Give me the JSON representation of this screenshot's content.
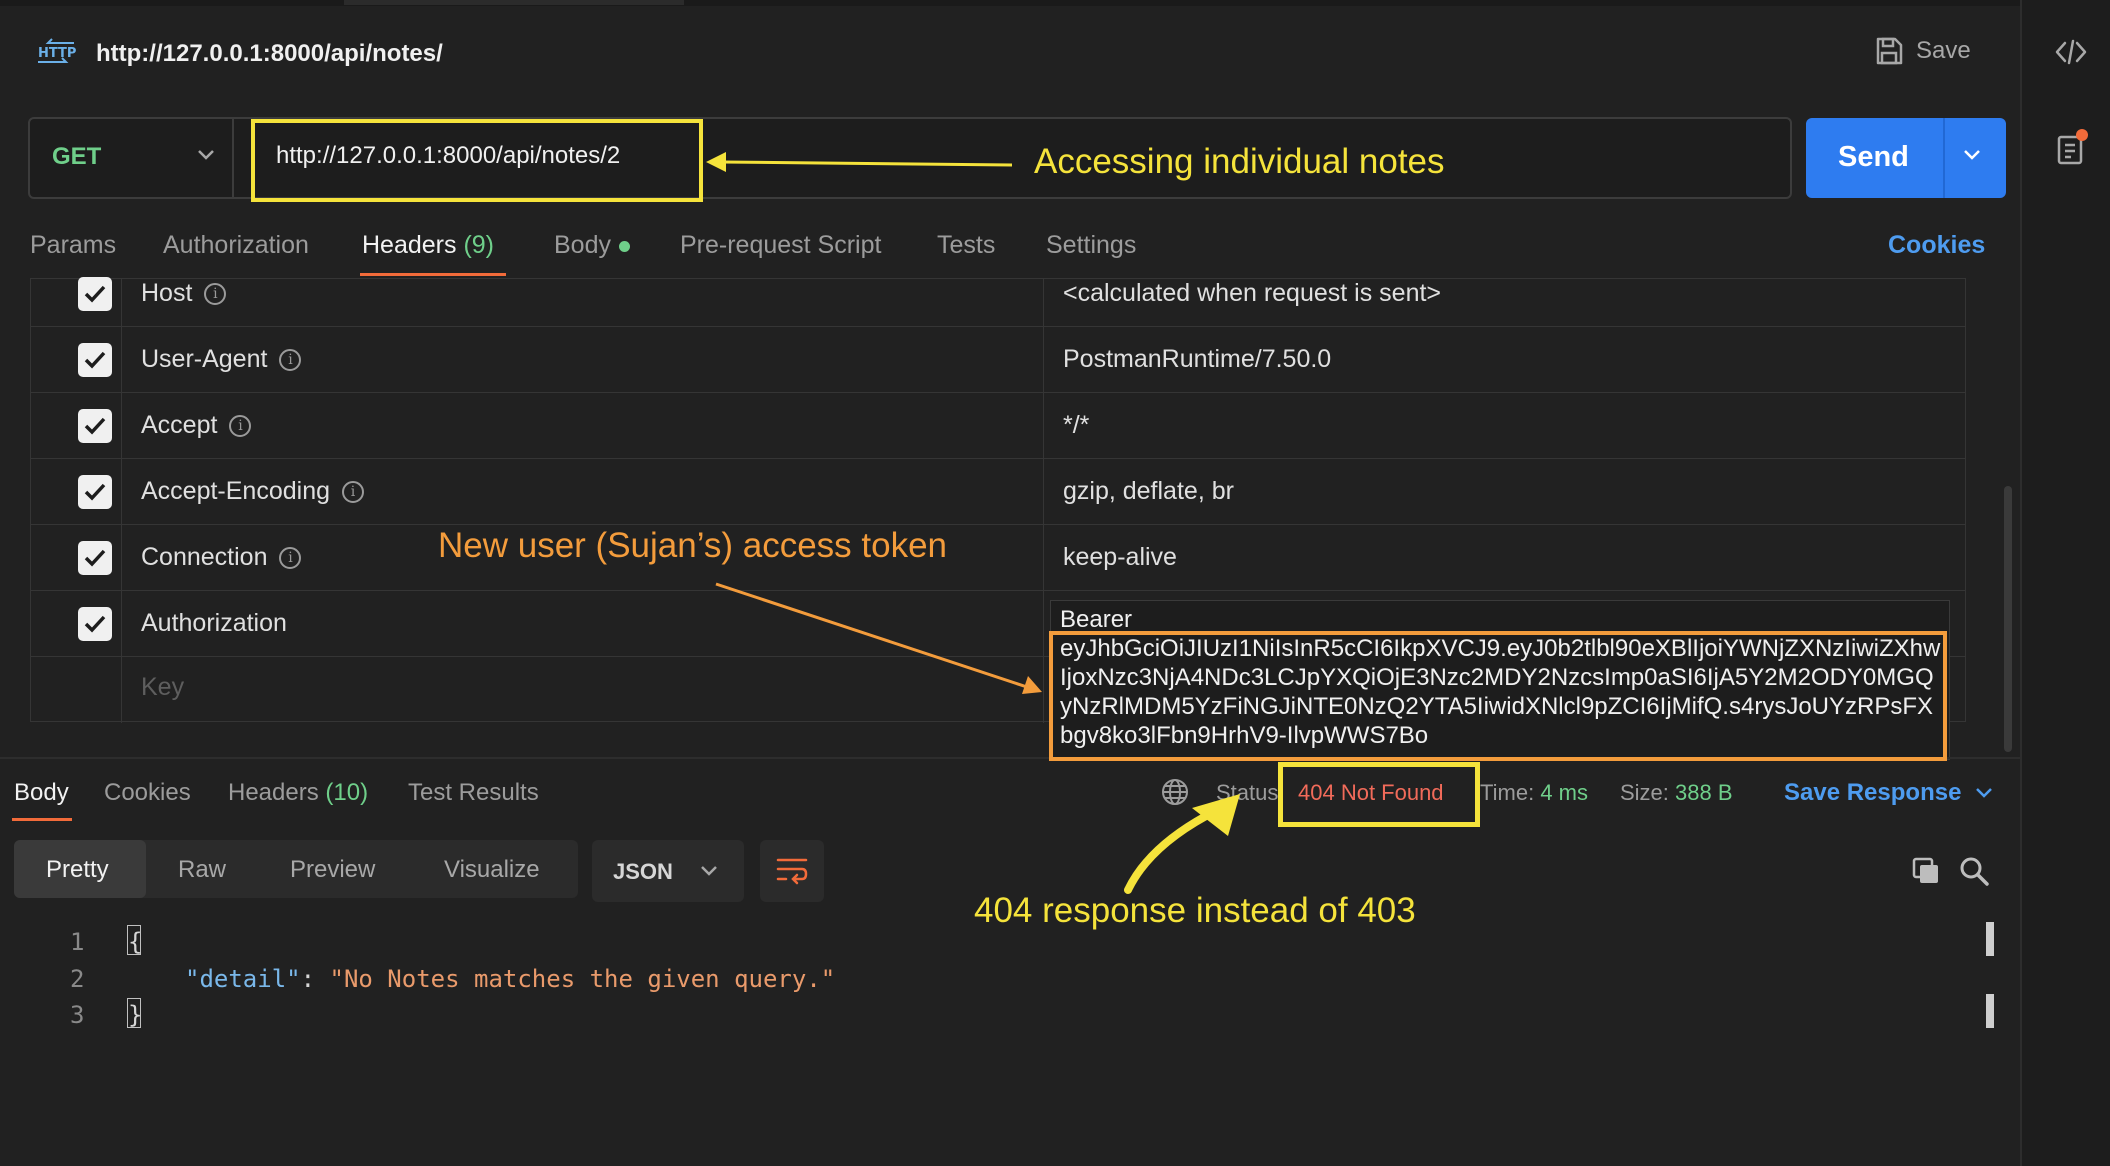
{
  "request": {
    "icon_text": "HTTP",
    "title": "http://127.0.0.1:8000/api/notes/",
    "save_label": "Save",
    "method": "GET",
    "url": "http://127.0.0.1:8000/api/notes/2",
    "send_label": "Send"
  },
  "tabs": [
    {
      "label": "Params"
    },
    {
      "label": "Authorization"
    },
    {
      "label": "Headers",
      "count": "(9)"
    },
    {
      "label": "Body"
    },
    {
      "label": "Pre-request Script"
    },
    {
      "label": "Tests"
    },
    {
      "label": "Settings"
    }
  ],
  "cookies_label": "Cookies",
  "headers": [
    {
      "key": "Host",
      "value": "<calculated when request is sent>"
    },
    {
      "key": "User-Agent",
      "value": "PostmanRuntime/7.50.0"
    },
    {
      "key": "Accept",
      "value": "*/*"
    },
    {
      "key": "Accept-Encoding",
      "value": "gzip, deflate, br"
    },
    {
      "key": "Connection",
      "value": "keep-alive"
    },
    {
      "key": "Authorization",
      "value_prefix": "Bearer",
      "token": "eyJhbGciOiJIUzI1NiIsInR5cCI6IkpXVCJ9.eyJ0b2tlbl90eXBlIjoiYWNjZXNzIiwiZXhwIjoxNzc3NjA4NDc3LCJpYXQiOjE3Nzc2MDY2NzcsImp0aSI6IjA5Y2M2ODY0MGQyNzRlMDM5YzFiNGJiNTE0NzQ2YTA5IiwidXNlcl9pZCI6IjMifQ.s4rysJoUYzRPsFXbgv8ko3lFbn9HrhV9-IlvpWWS7Bo"
    }
  ],
  "key_placeholder": "Key",
  "response": {
    "tabs": [
      {
        "label": "Body"
      },
      {
        "label": "Cookies"
      },
      {
        "label": "Headers",
        "count": "(10)"
      },
      {
        "label": "Test Results"
      }
    ],
    "status_label": "Status:",
    "status_value": "404 Not Found",
    "time_label": "Time:",
    "time_value": "4 ms",
    "size_label": "Size:",
    "size_value": "388 B",
    "save_response_label": "Save Response",
    "view_modes": [
      "Pretty",
      "Raw",
      "Preview",
      "Visualize"
    ],
    "format": "JSON",
    "code_lines": [
      "1",
      "2",
      "3"
    ],
    "open_brace": "{",
    "close_brace": "}",
    "json_key": "\"detail\"",
    "json_colon": ": ",
    "json_value": "\"No Notes matches the given query.\""
  },
  "annotations": {
    "url_note": "Accessing individual notes",
    "token_note": "New user (Sujan’s) access token",
    "status_note": "404 response instead of 403"
  },
  "colors": {
    "accent_send": "#2e7cf0",
    "method_green": "#6fcf8a",
    "status_red": "#f26b5a",
    "annotation_yellow": "#f5e33b",
    "annotation_orange": "#f39c3c"
  }
}
